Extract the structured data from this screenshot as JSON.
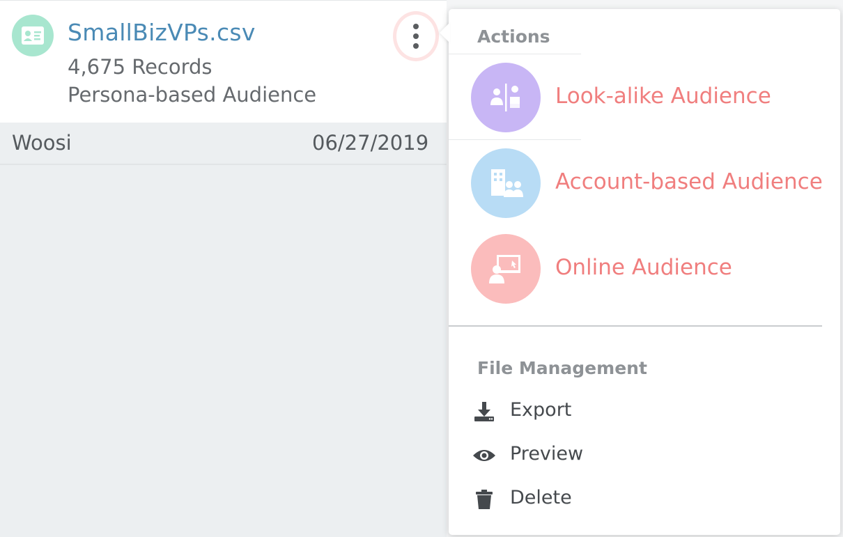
{
  "file": {
    "name": "SmallBizVPs.csv",
    "records": "4,675 Records",
    "type": "Persona-based Audience",
    "owner": "Woosi",
    "date": "06/27/2019"
  },
  "menu": {
    "actions_label": "Actions",
    "actions": [
      {
        "label": "Look-alike Audience",
        "icon": "lookalike-icon",
        "color": "#c8b6f5"
      },
      {
        "label": "Account-based Audience",
        "icon": "building-people-icon",
        "color": "#b8dcf5"
      },
      {
        "label": "Online Audience",
        "icon": "online-monitor-icon",
        "color": "#fbbcbc"
      }
    ],
    "file_management_label": "File Management",
    "file_actions": [
      {
        "label": "Export",
        "icon": "download-icon"
      },
      {
        "label": "Preview",
        "icon": "eye-icon"
      },
      {
        "label": "Delete",
        "icon": "trash-icon"
      }
    ]
  },
  "colors": {
    "accent_link": "#4a8ab5",
    "action_text": "#f07e7e",
    "file_avatar": "#a8e6cf"
  }
}
